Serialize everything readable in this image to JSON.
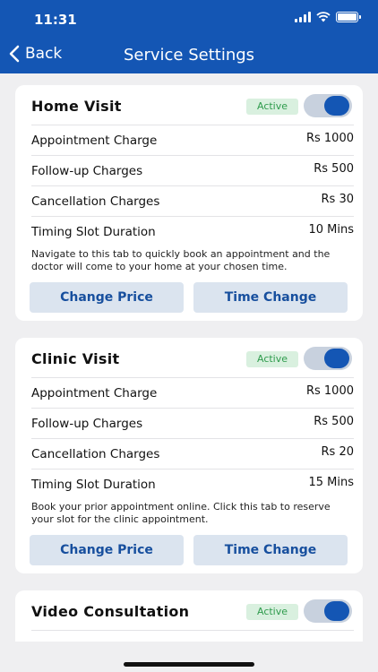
{
  "status_bar": {
    "time": "11:31"
  },
  "nav": {
    "back_label": "Back",
    "title": "Service Settings"
  },
  "cards": [
    {
      "title": "Home Visit",
      "status": "Active",
      "enabled": true,
      "rows": [
        {
          "label": "Appointment Charge",
          "value": "Rs 1000"
        },
        {
          "label": "Follow-up Charges",
          "value": "Rs 500"
        },
        {
          "label": "Cancellation Charges",
          "value": "Rs 30"
        },
        {
          "label": "Timing Slot Duration",
          "value": "10 Mins"
        }
      ],
      "description": "Navigate to this tab to quickly book an appointment and the doctor will come to your home at your chosen time.",
      "change_price_label": "Change Price",
      "time_change_label": "Time Change"
    },
    {
      "title": "Clinic Visit",
      "status": "Active",
      "enabled": true,
      "rows": [
        {
          "label": "Appointment Charge",
          "value": "Rs 1000"
        },
        {
          "label": "Follow-up Charges",
          "value": "Rs 500"
        },
        {
          "label": "Cancellation Charges",
          "value": "Rs 20"
        },
        {
          "label": "Timing Slot Duration",
          "value": "15 Mins"
        }
      ],
      "description": "Book your prior appointment online. Click this tab to reserve your slot for the clinic appointment.",
      "change_price_label": "Change Price",
      "time_change_label": "Time Change"
    },
    {
      "title": "Video Consultation",
      "status": "Active",
      "enabled": true
    }
  ],
  "colors": {
    "header": "#1456b4",
    "active_badge_bg": "#d9f0df",
    "active_badge_text": "#2e9b4c",
    "button_bg": "#dbe4ef",
    "button_text": "#174f9e"
  }
}
